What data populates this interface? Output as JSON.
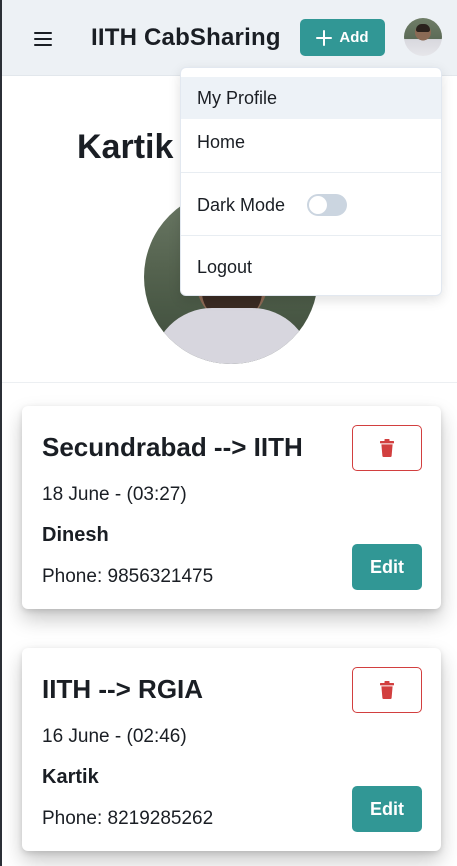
{
  "header": {
    "brand": "IITH CabSharing",
    "add_label": "Add"
  },
  "profile": {
    "name": "Kartik"
  },
  "dropdown": {
    "my_profile": "My Profile",
    "home": "Home",
    "dark_mode": "Dark Mode",
    "dark_mode_on": false,
    "logout": "Logout"
  },
  "rides": [
    {
      "route": "Secundrabad --> IITH",
      "datetime": "18 June - (03:27)",
      "name": "Dinesh",
      "phone": "Phone: 9856321475",
      "edit_label": "Edit"
    },
    {
      "route": "IITH --> RGIA",
      "datetime": "16 June - (02:46)",
      "name": "Kartik",
      "phone": "Phone: 8219285262",
      "edit_label": "Edit"
    }
  ],
  "colors": {
    "accent": "#319795",
    "danger": "#d23f3f",
    "header_bg": "#edf1f5"
  }
}
